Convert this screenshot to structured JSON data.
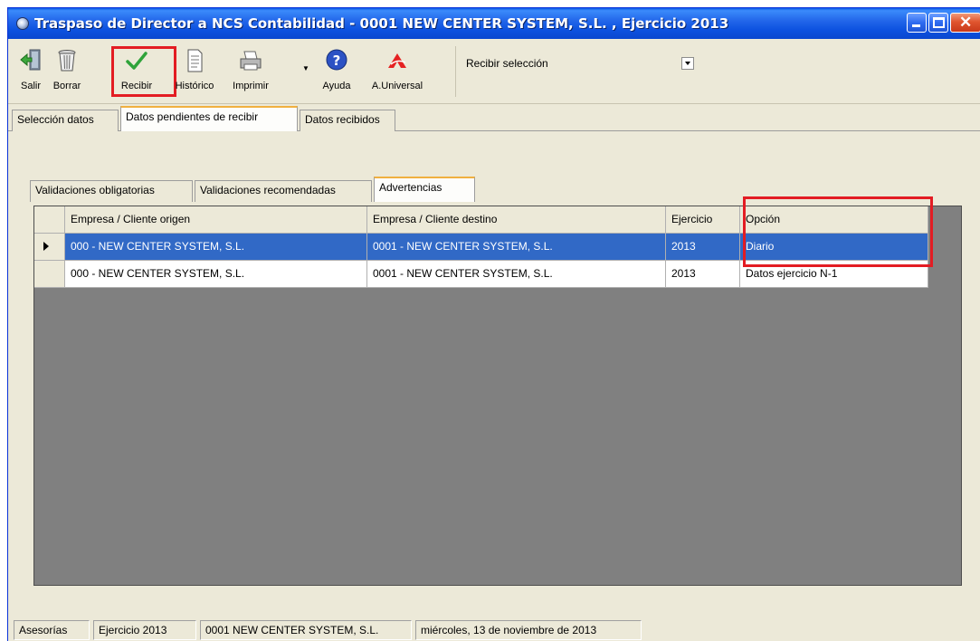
{
  "window": {
    "title": "Traspaso de Director a NCS Contabilidad - 0001 NEW CENTER SYSTEM, S.L. , Ejercicio 2013"
  },
  "toolbar": {
    "buttons": [
      {
        "label": "Salir",
        "icon": "exit-door-icon"
      },
      {
        "label": "Borrar",
        "icon": "trash-icon"
      },
      {
        "label": "Recibir",
        "icon": "checkmark-icon"
      },
      {
        "label": "Histórico",
        "icon": "document-icon"
      },
      {
        "label": "Imprimir",
        "icon": "printer-icon"
      },
      {
        "label": "Ayuda",
        "icon": "help-icon"
      },
      {
        "label": "A.Universal",
        "icon": "a-universal-logo-icon"
      }
    ],
    "receive_select": {
      "value": "Recibir selección"
    }
  },
  "tabs": {
    "main": [
      "Selección datos",
      "Datos pendientes de recibir",
      "Datos recibidos"
    ],
    "active_main": 1,
    "sub": [
      "Validaciones obligatorias",
      "Validaciones recomendadas",
      "Advertencias"
    ],
    "active_sub": 2
  },
  "grid": {
    "columns": [
      "Empresa / Cliente origen",
      "Empresa / Cliente destino",
      "Ejercicio",
      "Opción"
    ],
    "rows": [
      [
        "000 - NEW CENTER SYSTEM, S.L.",
        "0001 - NEW CENTER SYSTEM, S.L.",
        "2013",
        "Diario"
      ],
      [
        "000 - NEW CENTER SYSTEM, S.L.",
        "0001 - NEW CENTER SYSTEM, S.L.",
        "2013",
        "Datos ejercicio N-1"
      ]
    ],
    "selected_row": 0
  },
  "statusbar": {
    "items": [
      "Asesorías",
      "Ejercicio 2013",
      "0001 NEW CENTER SYSTEM, S.L.",
      "miércoles, 13 de noviembre de 2013"
    ]
  },
  "colors": {
    "titlebar": "#0a47cf",
    "selection": "#3169c6",
    "highlight_box": "#e31c23",
    "grid_background": "#808080"
  }
}
